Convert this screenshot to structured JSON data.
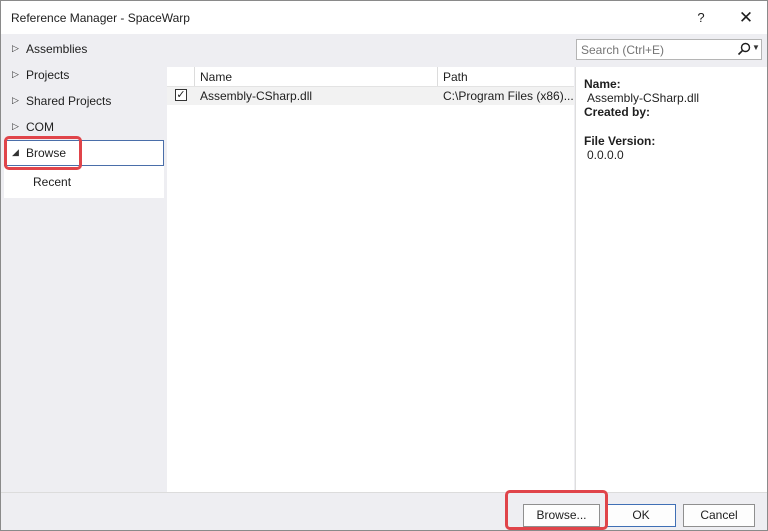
{
  "window": {
    "title": "Reference Manager - SpaceWarp",
    "help_label": "?",
    "close_label": "✕"
  },
  "nav": {
    "items": [
      {
        "label": "Assemblies",
        "arrow": "▷"
      },
      {
        "label": "Projects",
        "arrow": "▷"
      },
      {
        "label": "Shared Projects",
        "arrow": "▷"
      },
      {
        "label": "COM",
        "arrow": "▷"
      },
      {
        "label": "Browse",
        "arrow": "◢"
      }
    ],
    "sub_items": [
      {
        "label": "Recent"
      }
    ]
  },
  "search": {
    "placeholder": "Search (Ctrl+E)",
    "icon": "search-icon"
  },
  "list": {
    "columns": [
      "Name",
      "Path"
    ],
    "rows": [
      {
        "checked": "✓",
        "name": "Assembly-CSharp.dll",
        "path": "C:\\Program Files (x86)..."
      }
    ]
  },
  "details": {
    "name_label": "Name:",
    "name_value": "Assembly-CSharp.dll",
    "created_label": "Created by:",
    "version_label": "File Version:",
    "version_value": "0.0.0.0"
  },
  "footer": {
    "browse_label": "Browse...",
    "ok_label": "OK",
    "cancel_label": "Cancel"
  },
  "colors": {
    "highlight": "#e0444a",
    "selection_border": "#4a6ea9"
  }
}
